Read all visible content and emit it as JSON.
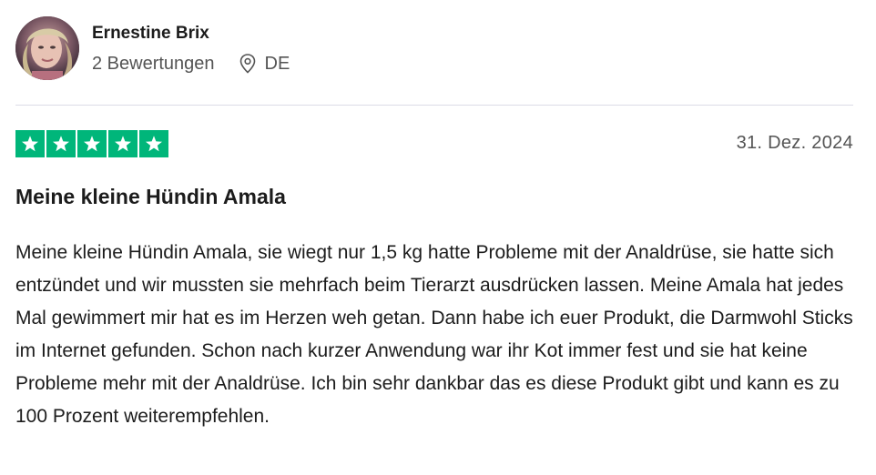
{
  "reviewer": {
    "name": "Ernestine Brix",
    "reviews_count": "2 Bewertungen",
    "country": "DE",
    "avatar_icon": "profile-photo",
    "location_icon": "map-pin-icon"
  },
  "review": {
    "rating": 5,
    "max_rating": 5,
    "star_color": "#00b67a",
    "date": "31. Dez. 2024",
    "title": "Meine kleine Hündin Amala",
    "body": "Meine kleine Hündin Amala, sie wiegt nur 1,5 kg hatte Probleme mit der Analdrüse, sie hatte sich entzündet und wir mussten sie mehrfach beim Tierarzt ausdrücken lassen. Meine Amala hat jedes Mal gewimmert mir hat es im Herzen weh getan. Dann habe ich euer Produkt, die Darmwohl Sticks im Internet gefunden. Schon nach kurzer Anwendung war ihr Kot immer fest und sie hat keine Probleme mehr mit der Analdrüse. Ich bin sehr dankbar das es diese Produkt gibt und kann es zu 100 Prozent weiterempfehlen."
  }
}
